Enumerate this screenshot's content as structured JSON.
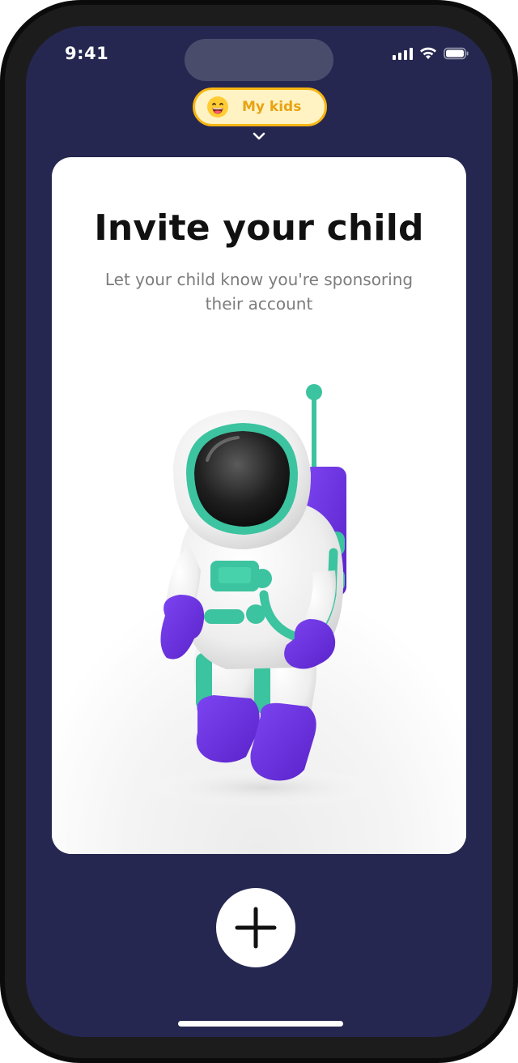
{
  "status_bar": {
    "time": "9:41",
    "icons": [
      "signal-icon",
      "wifi-icon",
      "battery-icon"
    ]
  },
  "header": {
    "kid_selector_label": "My kids",
    "kid_selector_icon": "grinning-face-icon",
    "dropdown_icon": "chevron-down-icon"
  },
  "card": {
    "title": "Invite your child",
    "subtitle": "Let your child know you're sponsoring their account",
    "illustration": "astronaut-illustration"
  },
  "actions": {
    "add_icon": "plus-icon"
  },
  "colors": {
    "screen_background": "#252750",
    "card_background": "#ffffff",
    "selector_border": "#f6b512",
    "selector_background": "#fff3c4",
    "selector_text": "#e8a312",
    "astronaut_accent": "#3cc39f",
    "astronaut_gloves": "#6a2fe0"
  }
}
